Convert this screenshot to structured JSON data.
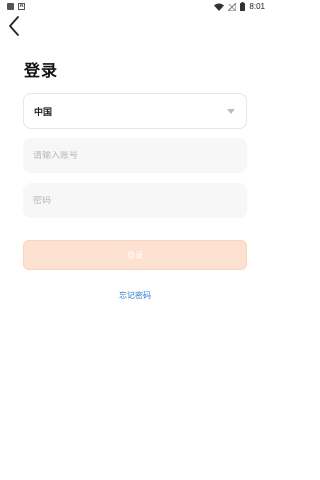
{
  "status_bar": {
    "time": "8:01"
  },
  "header": {
    "title": "登录"
  },
  "form": {
    "country_label": "中国",
    "account_placeholder": "请输入账号",
    "password_placeholder": "密码",
    "login_label": "登录"
  },
  "links": {
    "forgot_password": "忘记密码"
  },
  "colors": {
    "accent_disabled": "#fde1d0",
    "link": "#2a7ad0"
  }
}
